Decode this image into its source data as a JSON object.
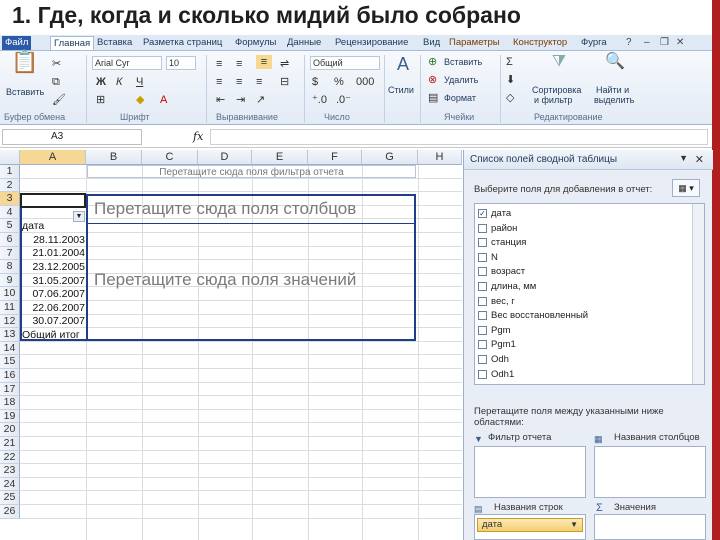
{
  "slide": {
    "title": "1. Где, когда и сколько мидий было собрано"
  },
  "tabs": [
    "Файл",
    "Главная",
    "Вставка",
    "Разметка страниц",
    "Формулы",
    "Данные",
    "Рецензирование",
    "Вид",
    "Параметры",
    "Конструктор",
    "Фурга"
  ],
  "ribbon": {
    "clipboard": {
      "paste": "Вставить",
      "label": "Буфер обмена"
    },
    "font": {
      "name": "Arial Cyr",
      "size": "10",
      "label": "Шрифт"
    },
    "alignment": {
      "label": "Выравнивание"
    },
    "number": {
      "format": "Общий",
      "label": "Число"
    },
    "styles": {
      "button": "Стили"
    },
    "cells": {
      "insert": "Вставить",
      "delete": "Удалить",
      "format": "Формат",
      "label": "Ячейки"
    },
    "editing": {
      "sort": "Сортировка",
      "sort2": "и фильтр",
      "find": "Найти и",
      "find2": "выделить",
      "label": "Редактирование"
    }
  },
  "formula_bar": {
    "cell_ref": "A3",
    "fx": "fx"
  },
  "sheet": {
    "columns": [
      "A",
      "B",
      "C",
      "D",
      "E",
      "F",
      "G",
      "H"
    ],
    "rows": [
      "1",
      "2",
      "3",
      "4",
      "5",
      "6",
      "7",
      "8",
      "9",
      "10",
      "11",
      "12",
      "13",
      "14",
      "15",
      "16",
      "17",
      "18",
      "19",
      "20",
      "21",
      "22",
      "23",
      "24",
      "25",
      "26"
    ],
    "filter_drop": "Перетащите сюда поля фильтра отчета",
    "column_drop": "Перетащите сюда поля столбцов",
    "value_drop": "Перетащите сюда поля значений",
    "row_header": "дата",
    "dates": [
      "28.11.2003",
      "21.01.2004",
      "23.12.2005",
      "31.05.2007",
      "07.06.2007",
      "22.06.2007",
      "30.07.2007"
    ],
    "total": "Общий итог"
  },
  "pivot_panel": {
    "title": "Список полей сводной таблицы",
    "choose_label": "Выберите поля для добавления в отчет:",
    "fields": [
      {
        "name": "дата",
        "checked": true
      },
      {
        "name": "район",
        "checked": false
      },
      {
        "name": "станция",
        "checked": false
      },
      {
        "name": "N",
        "checked": false
      },
      {
        "name": "возраст",
        "checked": false
      },
      {
        "name": "длина, мм",
        "checked": false
      },
      {
        "name": "вес, г",
        "checked": false
      },
      {
        "name": "Вес восстановленный",
        "checked": false
      },
      {
        "name": "Pgm",
        "checked": false
      },
      {
        "name": "Pgm1",
        "checked": false
      },
      {
        "name": "Odh",
        "checked": false
      },
      {
        "name": "Odh1",
        "checked": false
      }
    ],
    "drag_hint": "Перетащите поля между указанными ниже областями:",
    "areas": {
      "filter": "Фильтр отчета",
      "columns": "Названия столбцов",
      "rows": "Названия строк",
      "values": "Значения"
    },
    "row_chip": "дата"
  }
}
